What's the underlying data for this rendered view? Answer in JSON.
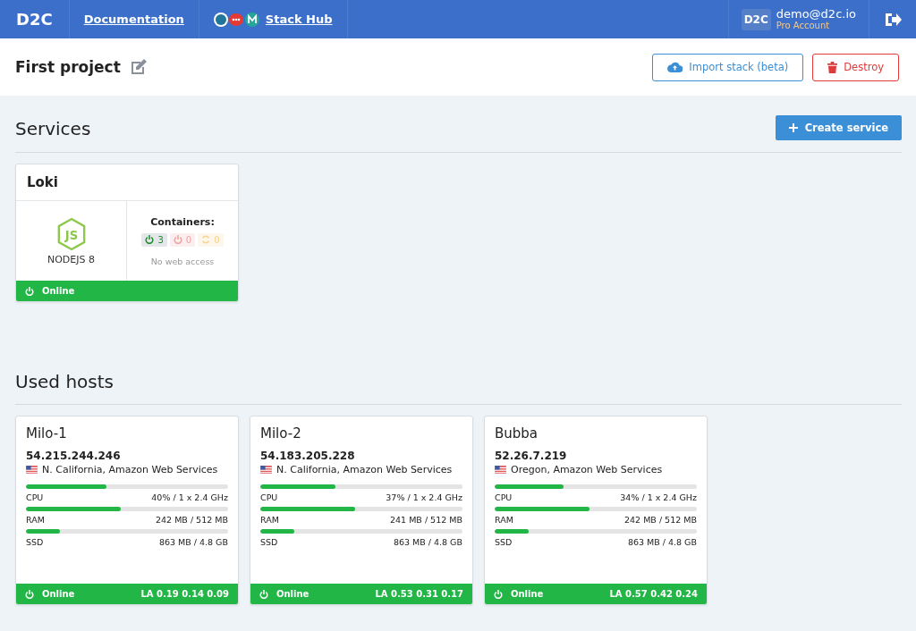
{
  "header": {
    "logo": "D2C",
    "links": [
      {
        "kind": "docs",
        "label": "Documentation"
      },
      {
        "kind": "hub",
        "label": "Stack Hub"
      }
    ],
    "user": {
      "avatar": "D2C",
      "email": "demo@d2c.io",
      "plan": "Pro Account"
    }
  },
  "project": {
    "title": "First project",
    "buttons": [
      {
        "kind": "import",
        "label": "Import stack (beta)"
      },
      {
        "kind": "destroy",
        "label": "Destroy"
      }
    ]
  },
  "services": {
    "title": "Services",
    "create_button": "Create service",
    "items": [
      {
        "name": "Loki",
        "logo": "JS",
        "runtime": "NODEJS 8",
        "containers_label": "Containers:",
        "containers": [
          {
            "kind": "running",
            "count": "3"
          },
          {
            "kind": "stopped",
            "count": "0"
          },
          {
            "kind": "restarting",
            "count": "0"
          }
        ],
        "web_access": "No web access",
        "status": "Online"
      }
    ]
  },
  "hosts": {
    "title": "Used hosts",
    "items": [
      {
        "name": "Milo-1",
        "ip": "54.215.244.246",
        "location": "N. California, Amazon Web Services",
        "metrics": [
          {
            "label": "CPU",
            "value": "40% / 1 x 2.4 GHz",
            "level": 0.4
          },
          {
            "label": "RAM",
            "value": "242 MB / 512 MB",
            "level": 0.47
          },
          {
            "label": "SSD",
            "value": "863 MB / 4.8 GB",
            "level": 0.17
          }
        ],
        "status": "Online",
        "load": "LA 0.19 0.14 0.09"
      },
      {
        "name": "Milo-2",
        "ip": "54.183.205.228",
        "location": "N. California, Amazon Web Services",
        "metrics": [
          {
            "label": "CPU",
            "value": "37% / 1 x 2.4 GHz",
            "level": 0.37
          },
          {
            "label": "RAM",
            "value": "241 MB / 512 MB",
            "level": 0.47
          },
          {
            "label": "SSD",
            "value": "863 MB / 4.8 GB",
            "level": 0.17
          }
        ],
        "status": "Online",
        "load": "LA 0.53 0.31 0.17"
      },
      {
        "name": "Bubba",
        "ip": "52.26.7.219",
        "location": "Oregon, Amazon Web Services",
        "metrics": [
          {
            "label": "CPU",
            "value": "34% / 1 x 2.4 GHz",
            "level": 0.34
          },
          {
            "label": "RAM",
            "value": "242 MB / 512 MB",
            "level": 0.47
          },
          {
            "label": "SSD",
            "value": "863 MB / 4.8 GB",
            "level": 0.17
          }
        ],
        "status": "Online",
        "load": "LA 0.57 0.42 0.24"
      }
    ]
  }
}
